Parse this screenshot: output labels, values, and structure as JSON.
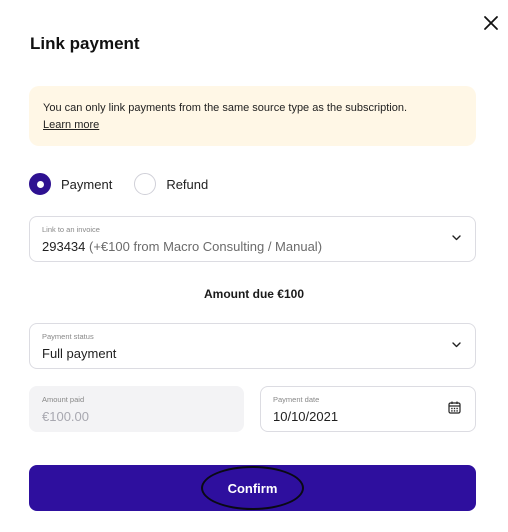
{
  "dialog": {
    "title": "Link payment",
    "close_icon": "close-icon"
  },
  "notice": {
    "text": "You can only link payments from the same source type as the subscription.",
    "link": "Learn more",
    "background": "#fff7e6"
  },
  "payment_type": {
    "options": [
      {
        "label": "Payment",
        "checked": true
      },
      {
        "label": "Refund",
        "checked": false
      }
    ],
    "accent": "#2e1191"
  },
  "invoice": {
    "label": "Link to an invoice",
    "value_main": "293434",
    "value_detail": " (+€100 from Macro Consulting / Manual)",
    "icon": "chevron-down-icon"
  },
  "amount_due": "Amount due €100",
  "payment_status": {
    "label": "Payment status",
    "value": "Full payment",
    "icon": "chevron-down-icon"
  },
  "amount_paid": {
    "label": "Amount paid",
    "value": "€100.00",
    "disabled": true
  },
  "payment_date": {
    "label": "Payment date",
    "value": "10/10/2021",
    "icon": "calendar-icon"
  },
  "confirm": {
    "label": "Confirm",
    "color": "#2e0f9e"
  }
}
